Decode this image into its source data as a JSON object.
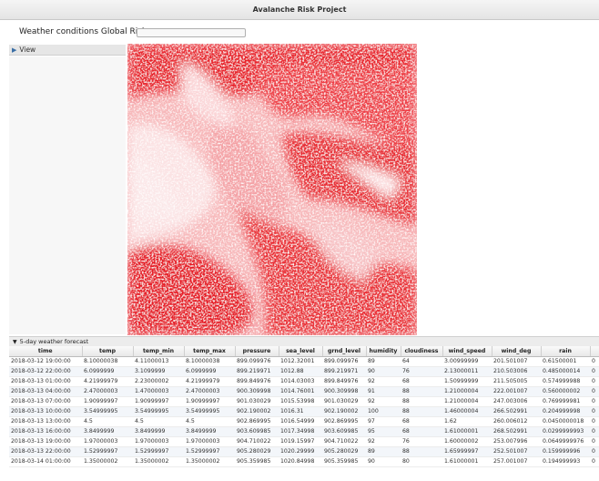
{
  "window": {
    "title": "Avalanche Risk Project"
  },
  "risk": {
    "label": "Weather conditions Global Risk",
    "value": ""
  },
  "view_panel": {
    "label": "View"
  },
  "forecast": {
    "title": "5-day weather forecast",
    "columns": [
      "time",
      "temp",
      "temp_min",
      "temp_max",
      "pressure",
      "sea_level",
      "grnd_level",
      "humidity",
      "cloudiness",
      "wind_speed",
      "wind_deg",
      "rain",
      ""
    ],
    "rows": [
      [
        "2018-03-12 19:00:00",
        "8.10000038",
        "4.11000013",
        "8.10000038",
        "899.099976",
        "1012.32001",
        "899.099976",
        "89",
        "64",
        "3.00999999",
        "201.501007",
        "0.61500001",
        "0"
      ],
      [
        "2018-03-12 22:00:00",
        "6.0999999",
        "3.1099999",
        "6.0999999",
        "899.219971",
        "1012.88",
        "899.219971",
        "90",
        "76",
        "2.13000011",
        "210.503006",
        "0.485000014",
        "0"
      ],
      [
        "2018-03-13 01:00:00",
        "4.21999979",
        "2.23000002",
        "4.21999979",
        "899.849976",
        "1014.03003",
        "899.849976",
        "92",
        "68",
        "1.50999999",
        "211.505005",
        "0.574999988",
        "0"
      ],
      [
        "2018-03-13 04:00:00",
        "2.47000003",
        "1.47000003",
        "2.47000003",
        "900.309998",
        "1014.76001",
        "900.309998",
        "91",
        "88",
        "1.21000004",
        "222.001007",
        "0.560000002",
        "0"
      ],
      [
        "2018-03-13 07:00:00",
        "1.90999997",
        "1.90999997",
        "1.90999997",
        "901.030029",
        "1015.53998",
        "901.030029",
        "92",
        "88",
        "1.21000004",
        "247.003006",
        "0.769999981",
        "0"
      ],
      [
        "2018-03-13 10:00:00",
        "3.54999995",
        "3.54999995",
        "3.54999995",
        "902.190002",
        "1016.31",
        "902.190002",
        "100",
        "88",
        "1.46000004",
        "266.502991",
        "0.204999998",
        "0"
      ],
      [
        "2018-03-13 13:00:00",
        "4.5",
        "4.5",
        "4.5",
        "902.869995",
        "1016.54999",
        "902.869995",
        "97",
        "68",
        "1.62",
        "260.006012",
        "0.0450000018",
        "0"
      ],
      [
        "2018-03-13 16:00:00",
        "3.8499999",
        "3.8499999",
        "3.8499999",
        "903.609985",
        "1017.34998",
        "903.609985",
        "95",
        "68",
        "1.61000001",
        "268.502991",
        "0.0299999993",
        "0"
      ],
      [
        "2018-03-13 19:00:00",
        "1.97000003",
        "1.97000003",
        "1.97000003",
        "904.710022",
        "1019.15997",
        "904.710022",
        "92",
        "76",
        "1.60000002",
        "253.007996",
        "0.0649999976",
        "0"
      ],
      [
        "2018-03-13 22:00:00",
        "1.52999997",
        "1.52999997",
        "1.52999997",
        "905.280029",
        "1020.29999",
        "905.280029",
        "89",
        "88",
        "1.65999997",
        "252.501007",
        "0.159999996",
        "0"
      ],
      [
        "2018-03-14 01:00:00",
        "1.35000002",
        "1.35000002",
        "1.35000002",
        "905.359985",
        "1020.84998",
        "905.359985",
        "90",
        "80",
        "1.61000001",
        "257.001007",
        "0.194999993",
        "0"
      ]
    ]
  }
}
